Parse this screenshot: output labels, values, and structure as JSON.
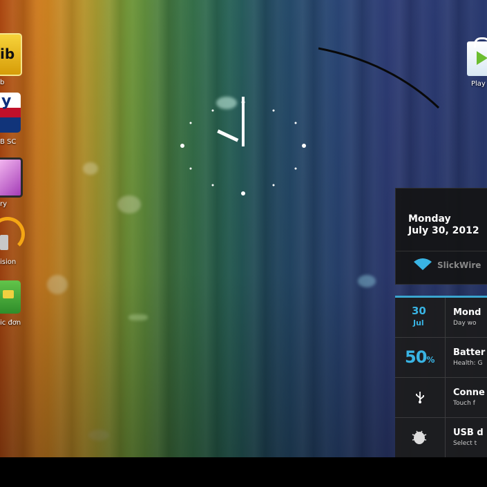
{
  "shortcuts": [
    {
      "label": "b",
      "icon": "imdb-icon",
      "color": "#e5b50e",
      "tile_text": "ib"
    },
    {
      "label": "B SC",
      "icon": "sky-sports-icon",
      "color": "#1f3f8f",
      "tile_text": "y"
    },
    {
      "label": "ry",
      "icon": "gallery-icon",
      "color": "#6b2f8e",
      "tile_text": ""
    },
    {
      "label": "ision",
      "icon": "music-headphones-icon",
      "color": "#f0a020",
      "tile_text": ""
    },
    {
      "label": "ic đơn",
      "icon": "app-icon",
      "color": "#3ea23e",
      "tile_text": ""
    }
  ],
  "play_store": {
    "label": "Play",
    "icon": "play-store-icon"
  },
  "date_widget": {
    "day": "Monday",
    "date": "July 30, 2012",
    "wifi_ssid": "SlickWire"
  },
  "status_widget": {
    "rows": [
      {
        "left_top": "30",
        "left_bottom": "Jul",
        "title": "Mond",
        "subtitle": "Day wo"
      },
      {
        "left_big": "50",
        "left_unit": "%",
        "title": "Batter",
        "subtitle": "Health: G"
      },
      {
        "icon": "usb-icon",
        "title": "Conne",
        "subtitle": "Touch f"
      },
      {
        "icon": "usb-debug-icon",
        "title": "USB d",
        "subtitle": "Select t"
      }
    ]
  },
  "colors": {
    "accent": "#39b4e4"
  }
}
